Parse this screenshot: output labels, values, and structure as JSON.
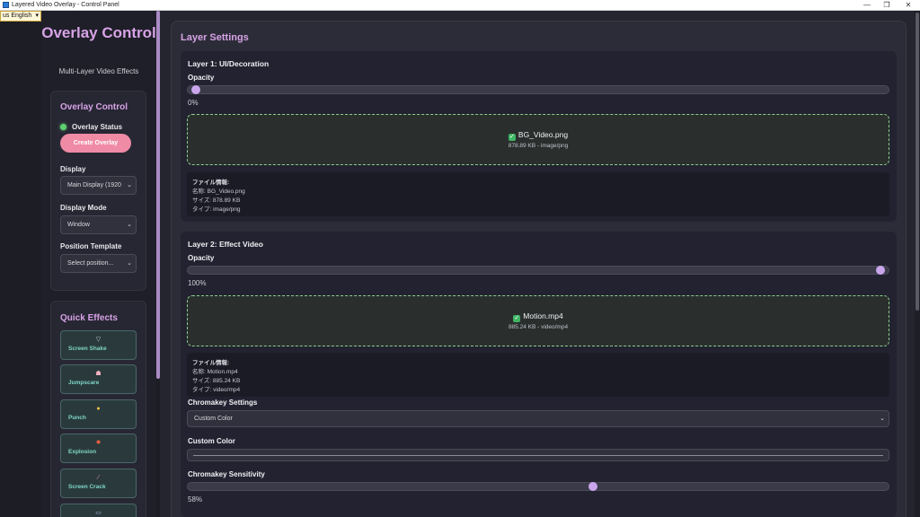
{
  "window": {
    "title": "Layered Video Overlay - Control Panel",
    "minimize": "—",
    "maximize": "❐",
    "close": "✕"
  },
  "language": {
    "selected": "us English",
    "caret": "▾"
  },
  "sidebar": {
    "brand_title": "Overlay Control",
    "brand_subtitle": "Multi-Layer Video Effects",
    "overlay_control": {
      "title": "Overlay Control",
      "status_label": "Overlay Status",
      "status_color": "#5fd070",
      "create_button": "Create Overlay",
      "display_label": "Display",
      "display_value": "Main Display (1920",
      "mode_label": "Display Mode",
      "mode_value": "Window",
      "template_label": "Position Template",
      "template_value": "Select position..."
    },
    "quick_effects": {
      "title": "Quick Effects",
      "items": [
        {
          "icon": "▽",
          "icon_name": "tornado-icon",
          "label": "Screen Shake"
        },
        {
          "icon": "☗",
          "icon_name": "ghost-icon",
          "label": "Jumpscare"
        },
        {
          "icon": "●",
          "icon_name": "fist-icon",
          "label": "Punch"
        },
        {
          "icon": "✹",
          "icon_name": "explosion-icon",
          "label": "Explosion"
        },
        {
          "icon": "⁄",
          "icon_name": "crack-icon",
          "label": "Screen Crack"
        },
        {
          "icon": "▭",
          "icon_name": "effect-icon",
          "label": ""
        }
      ]
    }
  },
  "main": {
    "title": "Layer Settings",
    "layer1": {
      "title": "Layer 1: UI/Decoration",
      "opacity_label": "Opacity",
      "opacity_value": "0%",
      "opacity_fraction": 0,
      "file_name": "BG_Video.png",
      "file_meta": "878.89 KB - image/png",
      "info_header": "ファイル情報:",
      "info_name": "名称: BG_Video.png",
      "info_size": "サイズ: 878.89 KB",
      "info_type": "タイプ: image/png"
    },
    "layer2": {
      "title": "Layer 2: Effect Video",
      "opacity_label": "Opacity",
      "opacity_value": "100%",
      "opacity_fraction": 1,
      "file_name": "Motion.mp4",
      "file_meta": "885.24 KB - video/mp4",
      "info_header": "ファイル情報:",
      "info_name": "名称: Motion.mp4",
      "info_size": "サイズ: 885.24 KB",
      "info_type": "タイプ: video/mp4",
      "chroma_label": "Chromakey Settings",
      "chroma_value": "Custom Color",
      "custom_color_label": "Custom Color",
      "sensitivity_label": "Chromakey Sensitivity",
      "sensitivity_value": "58%",
      "sensitivity_fraction": 0.58
    }
  },
  "colors": {
    "accent": "#d7a3e6",
    "button_pink": "#ef8ba5",
    "effect_text": "#7fd7c8",
    "dropzone_border": "#8ccf8a"
  }
}
